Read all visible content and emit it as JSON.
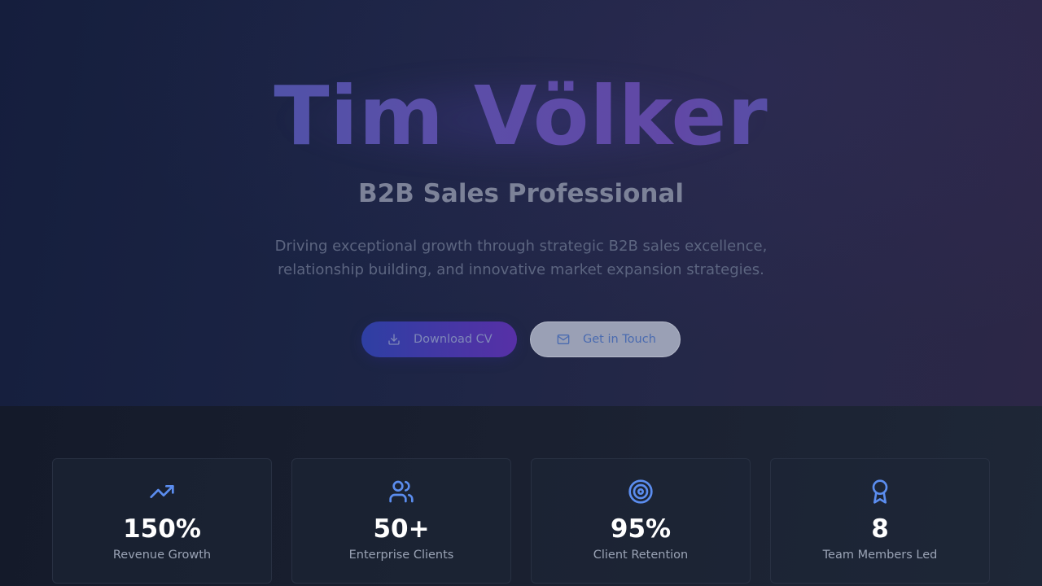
{
  "hero": {
    "name": "Tim Völker",
    "title": "B2B Sales Professional",
    "description": "Driving exceptional growth through strategic B2B sales excellence, relationship building, and innovative market expansion strategies.",
    "buttons": {
      "download": {
        "label": "Download CV",
        "icon": "download-icon"
      },
      "contact": {
        "label": "Get in Touch",
        "icon": "mail-icon"
      }
    }
  },
  "stats": [
    {
      "value": "150%",
      "label": "Revenue Growth",
      "icon": "trending-up-icon"
    },
    {
      "value": "50+",
      "label": "Enterprise Clients",
      "icon": "users-icon"
    },
    {
      "value": "95%",
      "label": "Client Retention",
      "icon": "target-icon"
    },
    {
      "value": "8",
      "label": "Team Members Led",
      "icon": "award-icon"
    }
  ],
  "colors": {
    "accent_blue": "#3b82f6",
    "accent_purple": "#6148a6",
    "stat_icon": "#5b8def"
  }
}
